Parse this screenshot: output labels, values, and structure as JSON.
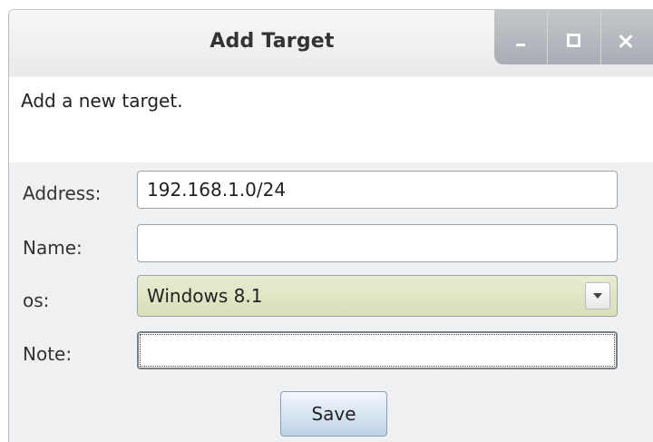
{
  "window": {
    "title": "Add Target",
    "controls": {
      "minimize": "minimize-icon",
      "maximize": "maximize-icon",
      "close": "close-icon"
    }
  },
  "description": "Add a new target.",
  "form": {
    "address": {
      "label": "Address:",
      "value": "192.168.1.0/24"
    },
    "name": {
      "label": "Name:",
      "value": ""
    },
    "os": {
      "label": "os:",
      "value": "Windows 8.1"
    },
    "note": {
      "label": "Note:",
      "value": ""
    }
  },
  "actions": {
    "save_label": "Save"
  },
  "colors": {
    "select_bg": "#dfe5c4",
    "save_button_bg": "#cfdfef",
    "titlebar_controls": "#b4b9be"
  }
}
